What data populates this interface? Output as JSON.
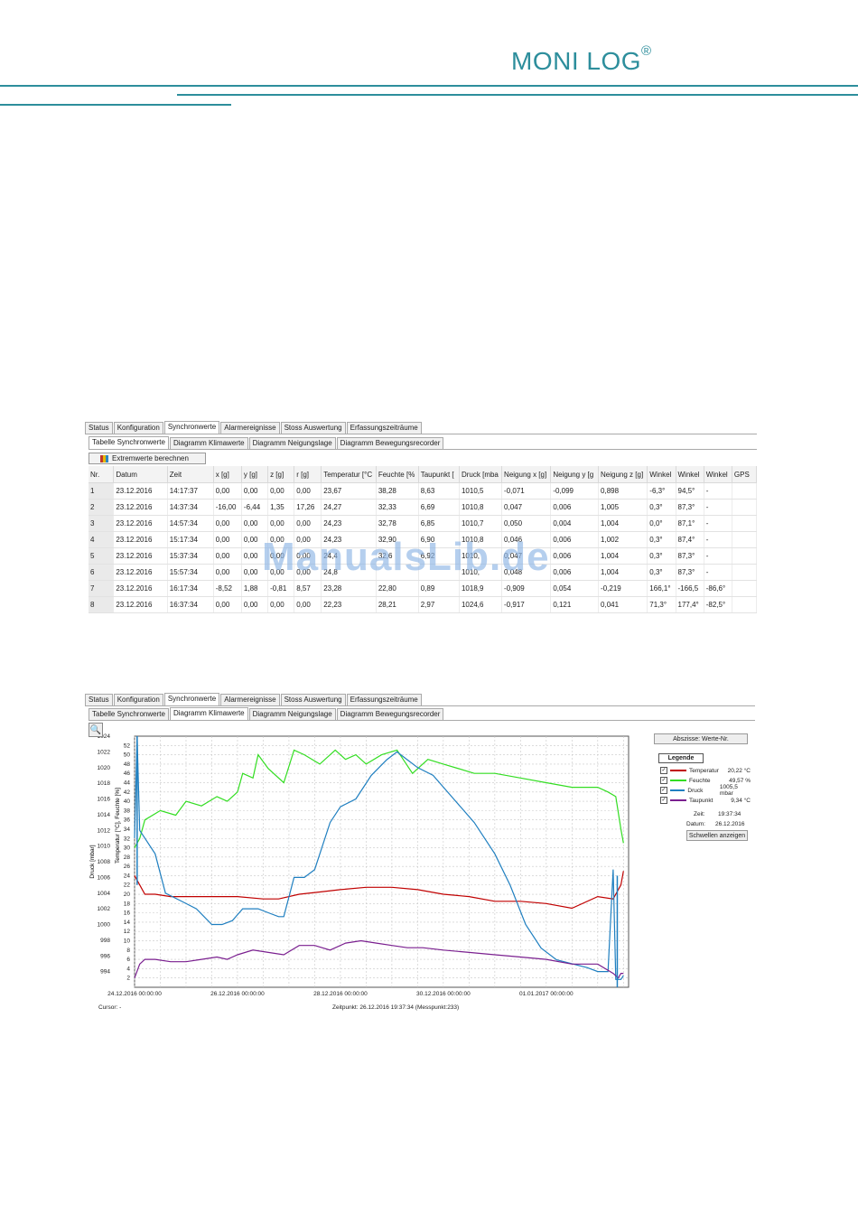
{
  "brand": {
    "name": "MONI LOG",
    "mark": "®",
    "color": "#2d8e9c"
  },
  "table_window": {
    "outer_tabs": [
      "Status",
      "Konfiguration",
      "Synchronwerte",
      "Alarmereignisse",
      "Stoss Auswertung",
      "Erfassungszeiträume"
    ],
    "outer_active": "Synchronwerte",
    "inner_tabs": [
      "Tabelle Synchronwerte",
      "Diagramm Klimawerte",
      "Diagramm Neigungslage",
      "Diagramm Bewegungsrecorder"
    ],
    "inner_active": "Tabelle Synchronwerte",
    "button": "Extremwerte berechnen",
    "columns": [
      "Nr.",
      "Datum",
      "Zeit",
      "x [g]",
      "y [g]",
      "z [g]",
      "r [g]",
      "Temperatur [°C",
      "Feuchte [%",
      "Taupunkt [",
      "Druck [mba",
      "Neigung x [g]",
      "Neigung y [g",
      "Neigung z [g]",
      "Winkel",
      "Winkel",
      "Winkel",
      "GPS"
    ],
    "rows": [
      [
        "1",
        "23.12.2016",
        "14:17:37",
        "0,00",
        "0,00",
        "0,00",
        "0,00",
        "23,67",
        "38,28",
        "8,63",
        "1010,5",
        "-0,071",
        "-0,099",
        "0,898",
        "-6,3°",
        "94,5°",
        "-",
        ""
      ],
      [
        "2",
        "23.12.2016",
        "14:37:34",
        "-16,00",
        "-6,44",
        "1,35",
        "17,26",
        "24,27",
        "32,33",
        "6,69",
        "1010,8",
        "0,047",
        "0,006",
        "1,005",
        "0,3°",
        "87,3°",
        "-",
        ""
      ],
      [
        "3",
        "23.12.2016",
        "14:57:34",
        "0,00",
        "0,00",
        "0,00",
        "0,00",
        "24,23",
        "32,78",
        "6,85",
        "1010,7",
        "0,050",
        "0,004",
        "1,004",
        "0,0°",
        "87,1°",
        "-",
        ""
      ],
      [
        "4",
        "23.12.2016",
        "15:17:34",
        "0,00",
        "0,00",
        "0,00",
        "0,00",
        "24,23",
        "32,90",
        "6,90",
        "1010,8",
        "0,046",
        "0,006",
        "1,002",
        "0,3°",
        "87,4°",
        "-",
        ""
      ],
      [
        "5",
        "23.12.2016",
        "15:37:34",
        "0,00",
        "0,00",
        "0,00",
        "0,00",
        "24,4",
        "32,6",
        "6,92",
        "1010,",
        "0,047",
        "0,006",
        "1,004",
        "0,3°",
        "87,3°",
        "-",
        ""
      ],
      [
        "6",
        "23.12.2016",
        "15:57:34",
        "0,00",
        "0,00",
        "0,00",
        "0,00",
        "24,8",
        "",
        "",
        "1010,",
        "0,048",
        "0,006",
        "1,004",
        "0,3°",
        "87,3°",
        "-",
        ""
      ],
      [
        "7",
        "23.12.2016",
        "16:17:34",
        "-8,52",
        "1,88",
        "-0,81",
        "8,57",
        "23,28",
        "22,80",
        "0,89",
        "1018,9",
        "-0,909",
        "0,054",
        "-0,219",
        "166,1°",
        "-166,5",
        "-86,6°",
        ""
      ],
      [
        "8",
        "23.12.2016",
        "16:37:34",
        "0,00",
        "0,00",
        "0,00",
        "0,00",
        "22,23",
        "28,21",
        "2,97",
        "1024,6",
        "-0,917",
        "0,121",
        "0,041",
        "71,3°",
        "177,4°",
        "-82,5°",
        ""
      ]
    ]
  },
  "watermark": "ManualsLib.de",
  "chart_window": {
    "outer_tabs": [
      "Status",
      "Konfiguration",
      "Synchronwerte",
      "Alarmereignisse",
      "Stoss Auswertung",
      "Erfassungszeiträume"
    ],
    "outer_active": "Synchronwerte",
    "inner_tabs": [
      "Tabelle Synchronwerte",
      "Diagramm Klimawerte",
      "Diagramm Neigungslage",
      "Diagramm Bewegungsrecorder"
    ],
    "inner_active": "Diagramm Klimawerte",
    "abscissa_button": "Abszisse: Werte-Nr.",
    "legend_title": "Legende",
    "legend": [
      {
        "name": "Temperatur",
        "value": "20,22 °C",
        "color": "#c00000",
        "checked": "✓"
      },
      {
        "name": "Feuchte",
        "value": "49,57 %",
        "color": "#33dd22",
        "checked": "✓"
      },
      {
        "name": "Druck",
        "value": "1005,5 mbar",
        "color": "#1f7fc0",
        "checked": "✓"
      },
      {
        "name": "Taupunkt",
        "value": "9,34 °C",
        "color": "#7a1f8f",
        "checked": "✓"
      }
    ],
    "time_label": "Zeit:",
    "time_value": "19:37:34",
    "date_label": "Datum:",
    "date_value": "26.12.2016",
    "threshold_button": "Schwellen anzeigen",
    "cursor": "Cursor: -",
    "zeitpunkt": "Zeitpunkt: 26.12.2016 19:37:34   (Messpunkt:233)"
  },
  "chart_data": {
    "type": "line",
    "x_tick_labels": [
      "24.12.2016 00:00:00",
      "26.12.2016 00:00:00",
      "28.12.2016 00:00:00",
      "30.12.2016 00:00:00",
      "01.01.2017 00:00:00"
    ],
    "x_range_days": [
      0,
      9.6
    ],
    "axes": [
      {
        "label": "Druck [mbar]",
        "ticks": [
          994,
          996,
          998,
          1000,
          1002,
          1004,
          1006,
          1008,
          1010,
          1012,
          1014,
          1016,
          1018,
          1020,
          1022,
          1024
        ],
        "range": [
          992,
          1024
        ]
      },
      {
        "label": "Temperatur [°C], Feuchte [%]",
        "ticks": [
          2,
          4,
          6,
          8,
          10,
          12,
          14,
          16,
          18,
          20,
          22,
          24,
          26,
          28,
          30,
          32,
          34,
          36,
          38,
          40,
          42,
          44,
          46,
          48,
          50,
          52
        ],
        "range": [
          0,
          54
        ]
      }
    ],
    "series": [
      {
        "name": "Feuchte",
        "axis": 1,
        "color": "#33dd22",
        "x": [
          0.0,
          0.1,
          0.2,
          0.5,
          0.8,
          1.0,
          1.3,
          1.6,
          1.8,
          2.0,
          2.1,
          2.3,
          2.4,
          2.6,
          2.9,
          3.1,
          3.3,
          3.6,
          3.9,
          4.1,
          4.3,
          4.5,
          4.8,
          5.1,
          5.4,
          5.7,
          6.0,
          6.3,
          6.6,
          7.0,
          7.5,
          8.0,
          8.5,
          9.0,
          9.2,
          9.35,
          9.45,
          9.5
        ],
        "y": [
          30,
          32,
          36,
          38,
          37,
          40,
          39,
          41,
          40,
          42,
          46,
          45,
          50,
          47,
          44,
          51,
          50,
          48,
          51,
          49,
          50,
          48,
          50,
          51,
          46,
          49,
          48,
          47,
          46,
          46,
          45,
          44,
          43,
          43,
          42,
          41,
          34,
          31
        ]
      },
      {
        "name": "Temperatur",
        "axis": 1,
        "color": "#c00000",
        "x": [
          0.0,
          0.1,
          0.2,
          0.4,
          0.7,
          1.0,
          1.5,
          2.0,
          2.5,
          2.8,
          3.2,
          3.6,
          4.0,
          4.5,
          5.0,
          5.5,
          6.0,
          6.5,
          7.0,
          7.5,
          8.0,
          8.5,
          9.0,
          9.3,
          9.45,
          9.5
        ],
        "y": [
          24,
          22,
          20,
          20,
          19.5,
          19.5,
          19.5,
          19.5,
          19,
          19,
          20,
          20.5,
          21,
          21.5,
          21.5,
          21,
          20,
          19.5,
          18.5,
          18.5,
          18,
          17,
          19.5,
          19,
          22,
          25
        ]
      },
      {
        "name": "Druck",
        "axis": 0,
        "color": "#1f7fc0",
        "x": [
          0.0,
          0.05,
          0.1,
          0.2,
          0.4,
          0.6,
          0.9,
          1.2,
          1.5,
          1.7,
          1.9,
          2.1,
          2.4,
          2.6,
          2.8,
          2.9,
          3.1,
          3.3,
          3.5,
          3.8,
          4.0,
          4.3,
          4.6,
          4.9,
          5.1,
          5.3,
          5.5,
          5.8,
          6.2,
          6.6,
          7.0,
          7.3,
          7.6,
          7.9,
          8.2,
          8.5,
          8.8,
          9.0,
          9.2,
          9.3,
          9.35,
          9.4,
          9.45,
          9.5
        ],
        "y": [
          1011,
          1024,
          1012,
          1011,
          1009,
          1004,
          1003,
          1002,
          1000,
          1000,
          1000.5,
          1002,
          1002,
          1001.5,
          1001,
          1001,
          1006,
          1006,
          1007,
          1013,
          1015,
          1016,
          1019,
          1021,
          1022,
          1021,
          1020,
          1019,
          1016,
          1013,
          1009,
          1005,
          1000,
          997,
          995.5,
          995,
          994.5,
          994,
          994,
          1007,
          993,
          993,
          993,
          993.5
        ]
      },
      {
        "name": "Taupunkt",
        "axis": 1,
        "color": "#7a1f8f",
        "x": [
          0.0,
          0.1,
          0.2,
          0.4,
          0.7,
          1.0,
          1.3,
          1.6,
          1.8,
          2.0,
          2.3,
          2.6,
          2.9,
          3.2,
          3.5,
          3.8,
          4.1,
          4.4,
          4.7,
          5.0,
          5.3,
          5.6,
          6.0,
          6.5,
          7.0,
          7.5,
          8.0,
          8.5,
          9.0,
          9.3,
          9.4,
          9.45,
          9.5
        ],
        "y": [
          2,
          5,
          6,
          6,
          5.5,
          5.5,
          6,
          6.5,
          6,
          7,
          8,
          7.5,
          7,
          9,
          9,
          8,
          9.5,
          10,
          9.5,
          9,
          8.5,
          8.5,
          8,
          7.5,
          7,
          6.5,
          6,
          5,
          5,
          3,
          2,
          3,
          3
        ]
      }
    ]
  }
}
